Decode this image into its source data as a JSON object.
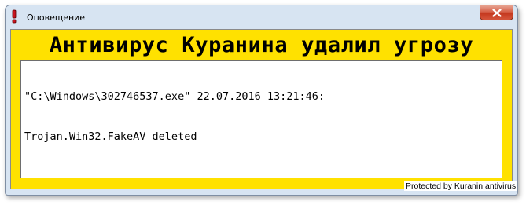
{
  "window": {
    "title": "Оповещение",
    "icon": "exclamation-icon",
    "close_icon": "close-icon"
  },
  "alert": {
    "headline": "Антивирус Куранина удалил угрозу",
    "message_lines": [
      "\"C:\\Windows\\302746537.exe\" 22.07.2016 13:21:46:",
      "Trojan.Win32.FakeAV deleted"
    ]
  },
  "footer": {
    "label": "Protected by Kuranin antivirus"
  },
  "colors": {
    "alert_background": "#ffe100",
    "frame_background": "#d7e4f2",
    "close_button": "#c4381f"
  }
}
